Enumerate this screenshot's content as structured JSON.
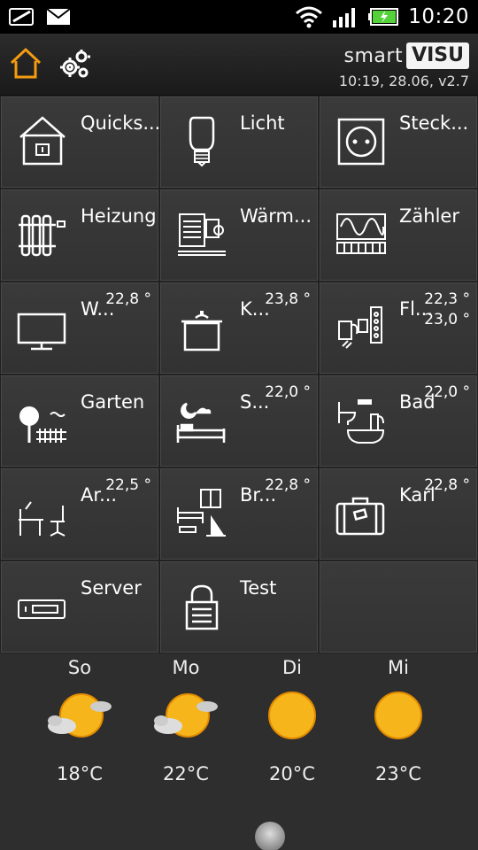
{
  "statusbar": {
    "time": "10:20",
    "icons": [
      "wifi-icon",
      "signal-icon",
      "battery-charging-icon",
      "sim-icon",
      "mail-icon"
    ]
  },
  "header": {
    "brand_smart": "smart",
    "brand_visu": "VISU",
    "info": "10:19, 28.06, v2.7",
    "accent_color": "#f39c12"
  },
  "tiles": [
    {
      "label": "Quicks...",
      "icon": "house-icon"
    },
    {
      "label": "Licht",
      "icon": "bulb-icon"
    },
    {
      "label": "Steck...",
      "icon": "socket-icon"
    },
    {
      "label": "Heizung",
      "icon": "radiator-icon"
    },
    {
      "label": "Wärm...",
      "icon": "heatpump-icon"
    },
    {
      "label": "Zähler",
      "icon": "meter-icon"
    },
    {
      "label": "W...",
      "icon": "tv-icon",
      "value": "22,8 °"
    },
    {
      "label": "K...",
      "icon": "pot-icon",
      "value": "23,8 °"
    },
    {
      "label": "Fl...",
      "icon": "intercom-icon",
      "value": "22,3 °",
      "value2": "23,0 °"
    },
    {
      "label": "Garten",
      "icon": "garden-icon"
    },
    {
      "label": "S...",
      "icon": "bed-night-icon",
      "value": "22,0 °"
    },
    {
      "label": "Bad",
      "icon": "bath-icon",
      "value": "22,0 °"
    },
    {
      "label": "Ar...",
      "icon": "desk-icon",
      "value": "22,5 °"
    },
    {
      "label": "Br...",
      "icon": "kids-room-icon",
      "value": "22,8 °"
    },
    {
      "label": "Karl",
      "icon": "suitcase-icon",
      "value": "22,8 °"
    },
    {
      "label": "Server",
      "icon": "server-icon"
    },
    {
      "label": "Test",
      "icon": "lock-icon"
    }
  ],
  "weather": [
    {
      "day": "So",
      "temp": "18°C",
      "icon": "sun-cloud-icon"
    },
    {
      "day": "Mo",
      "temp": "22°C",
      "icon": "sun-cloud-icon"
    },
    {
      "day": "Di",
      "temp": "20°C",
      "icon": "sun-icon"
    },
    {
      "day": "Mi",
      "temp": "23°C",
      "icon": "sun-icon"
    }
  ]
}
